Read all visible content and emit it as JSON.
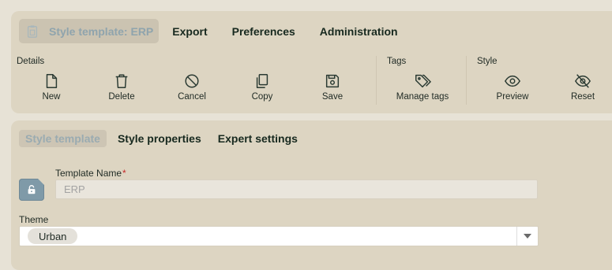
{
  "ribbon": {
    "tabs": [
      {
        "label": "Style template: ERP",
        "icon": "clipboard-icon",
        "active": true
      },
      {
        "label": "Export"
      },
      {
        "label": "Preferences"
      },
      {
        "label": "Administration"
      }
    ],
    "groups": {
      "details": "Details",
      "tags": "Tags",
      "style": "Style"
    },
    "actions": {
      "new": {
        "label": "New",
        "icon": "file-icon"
      },
      "delete": {
        "label": "Delete",
        "icon": "trash-icon"
      },
      "cancel": {
        "label": "Cancel",
        "icon": "ban-icon"
      },
      "copy": {
        "label": "Copy",
        "icon": "copy-icon"
      },
      "save": {
        "label": "Save",
        "icon": "floppy-icon"
      },
      "manage_tags": {
        "label": "Manage tags",
        "icon": "tags-icon"
      },
      "preview": {
        "label": "Preview",
        "icon": "eye-icon"
      },
      "reset": {
        "label": "Reset",
        "icon": "eye-slash-icon"
      }
    }
  },
  "form": {
    "tabs": [
      {
        "label": "Style template",
        "active": true
      },
      {
        "label": "Style properties"
      },
      {
        "label": "Expert settings"
      }
    ],
    "template_name": {
      "label": "Template Name",
      "required_mark": "*",
      "placeholder": "ERP"
    },
    "theme": {
      "label": "Theme",
      "value": "Urban"
    }
  },
  "colors": {
    "background": "#e7e2d6",
    "panel": "#ddd5c2",
    "active_tab_text": "#8fa4ad",
    "lock_badge": "#7f9aa8",
    "required": "#c62828"
  }
}
